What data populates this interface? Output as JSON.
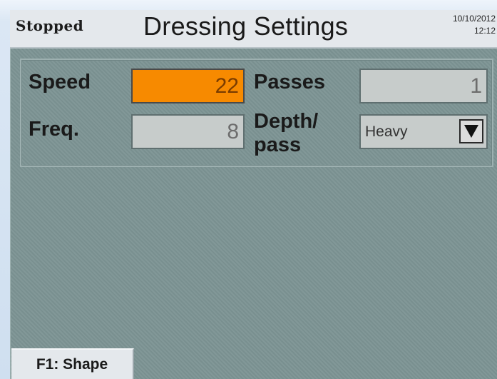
{
  "header": {
    "status": "Stopped",
    "title": "Dressing Settings",
    "date": "10/10/2012",
    "time": "12:12"
  },
  "settings": {
    "speed": {
      "label": "Speed",
      "value": "22",
      "active": true,
      "color": "#f78a00"
    },
    "passes": {
      "label": "Passes",
      "value": "1"
    },
    "freq": {
      "label": "Freq.",
      "value": "8"
    },
    "depth_per_pass": {
      "label_line1": "Depth/",
      "label_line2": "pass",
      "selected": "Heavy",
      "icon": "chevron-down-icon"
    }
  },
  "function_keys": {
    "f1": "F1: Shape"
  }
}
